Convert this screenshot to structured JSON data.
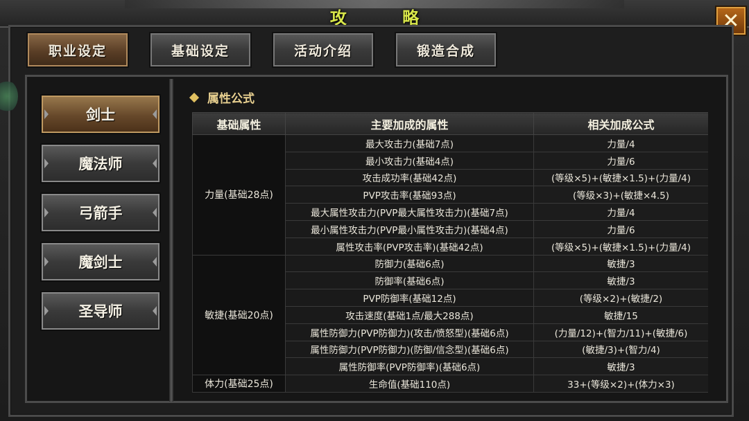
{
  "window": {
    "title": "攻 略",
    "close_label": "✕"
  },
  "tabs": [
    {
      "label": "职业设定",
      "active": true
    },
    {
      "label": "基础设定",
      "active": false
    },
    {
      "label": "活动介绍",
      "active": false
    },
    {
      "label": "锻造合成",
      "active": false
    }
  ],
  "roles": [
    {
      "label": "剑士",
      "active": true
    },
    {
      "label": "魔法师",
      "active": false
    },
    {
      "label": "弓箭手",
      "active": false
    },
    {
      "label": "魔剑士",
      "active": false
    },
    {
      "label": "圣导师",
      "active": false
    }
  ],
  "section": {
    "title": "属性公式"
  },
  "table": {
    "headers": [
      "基础属性",
      "主要加成的属性",
      "相关加成公式"
    ],
    "groups": [
      {
        "base": "力量(基础28点)",
        "rows": [
          [
            "最大攻击力(基础7点)",
            "力量/4"
          ],
          [
            "最小攻击力(基础4点)",
            "力量/6"
          ],
          [
            "攻击成功率(基础42点)",
            "(等级×5)+(敏捷×1.5)+(力量/4)"
          ],
          [
            "PVP攻击率(基础93点)",
            "(等级×3)+(敏捷×4.5)"
          ],
          [
            "最大属性攻击力(PVP最大属性攻击力)(基础7点)",
            "力量/4"
          ],
          [
            "最小属性攻击力(PVP最小属性攻击力)(基础4点)",
            "力量/6"
          ],
          [
            "属性攻击率(PVP攻击率)(基础42点)",
            "(等级×5)+(敏捷×1.5)+(力量/4)"
          ]
        ]
      },
      {
        "base": "敏捷(基础20点)",
        "rows": [
          [
            "防御力(基础6点)",
            "敏捷/3"
          ],
          [
            "防御率(基础6点)",
            "敏捷/3"
          ],
          [
            "PVP防御率(基础12点)",
            "(等级×2)+(敏捷/2)"
          ],
          [
            "攻击速度(基础1点/最大288点)",
            "敏捷/15"
          ],
          [
            "属性防御力(PVP防御力)(攻击/愤怒型)(基础6点)",
            "(力量/12)+(智力/11)+(敏捷/6)"
          ],
          [
            "属性防御力(PVP防御力)(防御/信念型)(基础6点)",
            "(敏捷/3)+(智力/4)"
          ],
          [
            "属性防御率(PVP防御率)(基础6点)",
            "敏捷/3"
          ]
        ]
      },
      {
        "base": "体力(基础25点)",
        "rows": [
          [
            "生命值(基础110点)",
            "33+(等级×2)+(体力×3)"
          ]
        ]
      }
    ]
  }
}
